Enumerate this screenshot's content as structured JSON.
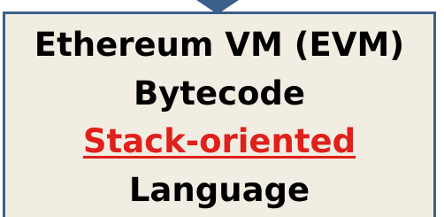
{
  "box": {
    "line1": "Ethereum VM (EVM)",
    "line2": "Bytecode",
    "line3": "Stack-oriented",
    "line4": "Language"
  },
  "colors": {
    "box_fill": "#f2ede2",
    "box_border": "#3a5f8a",
    "arrow": "#3a5f8a",
    "text": "#000000",
    "emphasis": "#e0201b"
  }
}
